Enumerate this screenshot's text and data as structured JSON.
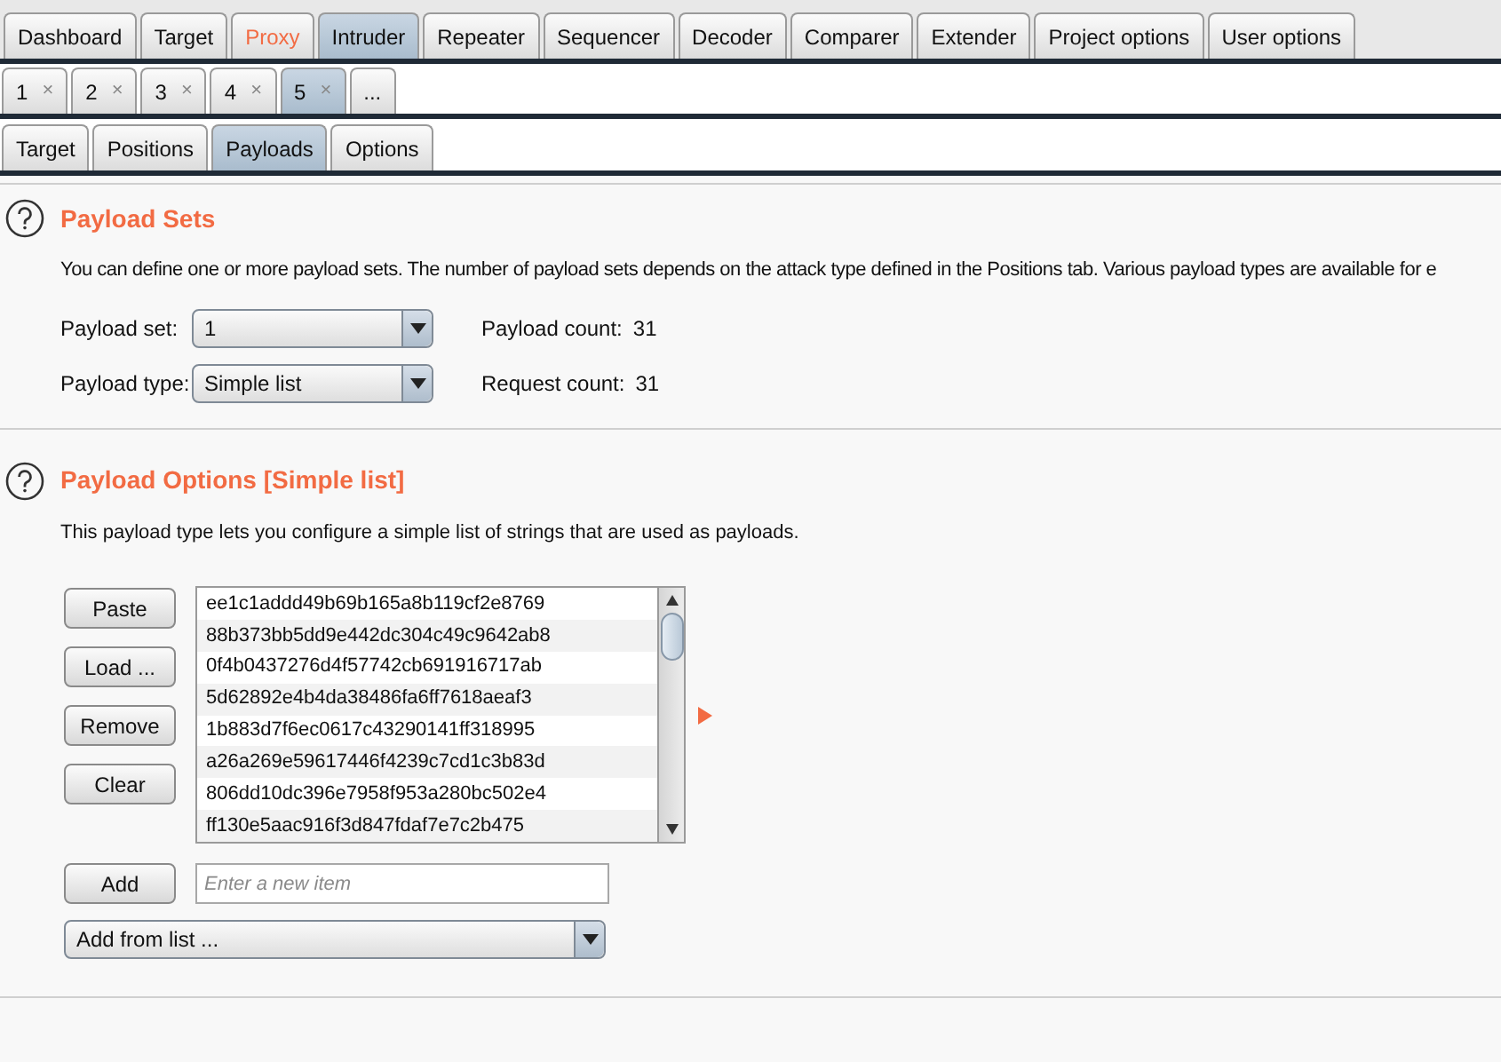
{
  "main_tabs": [
    {
      "label": "Dashboard",
      "selected": false,
      "highlighted": false
    },
    {
      "label": "Target",
      "selected": false,
      "highlighted": false
    },
    {
      "label": "Proxy",
      "selected": false,
      "highlighted": true
    },
    {
      "label": "Intruder",
      "selected": true,
      "highlighted": false
    },
    {
      "label": "Repeater",
      "selected": false,
      "highlighted": false
    },
    {
      "label": "Sequencer",
      "selected": false,
      "highlighted": false
    },
    {
      "label": "Decoder",
      "selected": false,
      "highlighted": false
    },
    {
      "label": "Comparer",
      "selected": false,
      "highlighted": false
    },
    {
      "label": "Extender",
      "selected": false,
      "highlighted": false
    },
    {
      "label": "Project options",
      "selected": false,
      "highlighted": false
    },
    {
      "label": "User options",
      "selected": false,
      "highlighted": false
    }
  ],
  "attack_tabs": [
    {
      "label": "1",
      "close": "×",
      "selected": false
    },
    {
      "label": "2",
      "close": "×",
      "selected": false
    },
    {
      "label": "3",
      "close": "×",
      "selected": false
    },
    {
      "label": "4",
      "close": "×",
      "selected": false
    },
    {
      "label": "5",
      "close": "×",
      "selected": true
    }
  ],
  "more_tab": "...",
  "sub_tabs": [
    {
      "label": "Target",
      "selected": false
    },
    {
      "label": "Positions",
      "selected": false
    },
    {
      "label": "Payloads",
      "selected": true
    },
    {
      "label": "Options",
      "selected": false
    }
  ],
  "payload_sets": {
    "title": "Payload Sets",
    "description": "You can define one or more payload sets. The number of payload sets depends on the attack type defined in the Positions tab. Various payload types are available for e",
    "fields": [
      {
        "label": "Payload set:",
        "value": "1",
        "info_label": "Payload count:",
        "info_value": "31"
      },
      {
        "label": "Payload type:",
        "value": "Simple list",
        "info_label": "Request count:",
        "info_value": "31"
      }
    ]
  },
  "payload_options": {
    "title": "Payload Options [Simple list]",
    "description": "This payload type lets you configure a simple list of strings that are used as payloads.",
    "buttons": [
      "Paste",
      "Load ...",
      "Remove",
      "Clear"
    ],
    "items": [
      "ee1c1addd49b69b165a8b119cf2e8769",
      "88b373bb5dd9e442dc304c49c9642ab8",
      "0f4b0437276d4f57742cb691916717ab",
      "5d62892e4b4da38486fa6ff7618aeaf3",
      "1b883d7f6ec0617c43290141ff318995",
      "a26a269e59617446f4239c7cd1c3b83d",
      "806dd10dc396e7958f953a280bc502e4",
      "ff130e5aac916f3d847fdaf7e7c2b475"
    ],
    "add_button": "Add",
    "new_item": {
      "placeholder": "Enter a new item"
    },
    "add_from_list": "Add from list ..."
  }
}
